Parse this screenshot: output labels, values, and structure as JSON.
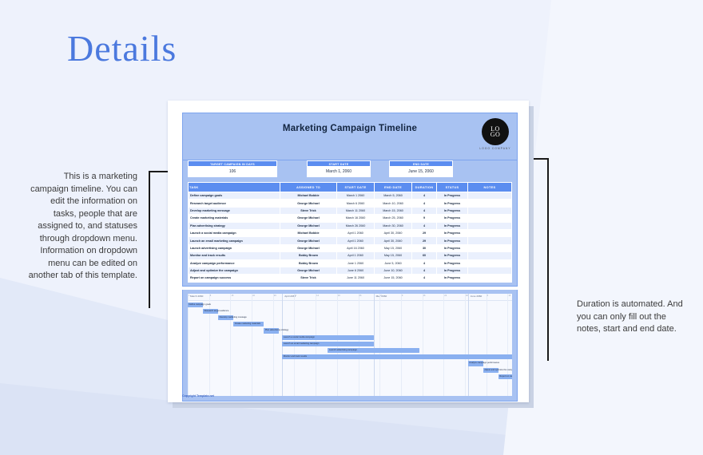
{
  "page": {
    "title": "Details"
  },
  "document": {
    "header": {
      "title": "Marketing Campaign Timeline",
      "logo_line1": "LO",
      "logo_line2": "GO",
      "logo_subtitle": "LOGO COMPANY"
    },
    "info_boxes": [
      {
        "label": "TARGET CAMPAIGN IN DAYS",
        "value": "106"
      },
      {
        "label": "START DATE",
        "value": "March 1, 2060"
      },
      {
        "label": "END DATE",
        "value": "June 15, 2060"
      }
    ],
    "table": {
      "columns": [
        "TASK",
        "ASSIGNED TO",
        "START DATE",
        "END DATE",
        "DURATION",
        "STATUS",
        "NOTES"
      ],
      "rows": [
        [
          "Define campaign goals",
          "Michael Bobbie",
          "March 1 2060",
          "March 5, 2060",
          "4",
          "In Progress",
          ""
        ],
        [
          "Research target audience",
          "George Michael",
          "March 6 2060",
          "March 10, 2060",
          "4",
          "In Progress",
          ""
        ],
        [
          "Develop marketing message",
          "Steve Trick",
          "March 11 2060",
          "March 15, 2060",
          "4",
          "In Progress",
          ""
        ],
        [
          "Create marketing materials",
          "George Michael",
          "March 16 2060",
          "March 25, 2060",
          "9",
          "In Progress",
          ""
        ],
        [
          "Plan advertising strategy",
          "George Michael",
          "March 26 2060",
          "March 30, 2060",
          "4",
          "In Progress",
          ""
        ],
        [
          "Launch a social media campaign",
          "Michael Bobbie",
          "April 1 2060",
          "April 30, 2060",
          "29",
          "In Progress",
          ""
        ],
        [
          "Launch an email marketing campaign",
          "George Michael",
          "April 1 2060",
          "April 30, 2060",
          "29",
          "In Progress",
          ""
        ],
        [
          "Launch advertising campaign",
          "George Michael",
          "April 16 2060",
          "May 15, 2060",
          "30",
          "In Progress",
          ""
        ],
        [
          "Monitor and track results",
          "Bobby Brown",
          "April 1 2060",
          "May 15, 2060",
          "60",
          "In Progress",
          ""
        ],
        [
          "Analyze campaign performance",
          "Bobby Brown",
          "June 1 2060",
          "June 5, 2060",
          "4",
          "In Progress",
          ""
        ],
        [
          "Adjust and optimize the campaign",
          "George Michael",
          "June 6 2060",
          "June 10, 2060",
          "4",
          "In Progress",
          ""
        ],
        [
          "Report on campaign success",
          "Steve Trick",
          "June 11 2060",
          "June 15, 2060",
          "4",
          "In Progress",
          ""
        ]
      ]
    },
    "gantt": {
      "months": [
        "March 2060",
        "April 2060",
        "May 2060",
        "June 2060"
      ],
      "bars": [
        {
          "label": "Define campaign goals",
          "start": 0,
          "length": 5
        },
        {
          "label": "Research target audience",
          "start": 5,
          "length": 5
        },
        {
          "label": "Develop marketing message",
          "start": 10,
          "length": 5
        },
        {
          "label": "Create marketing materials",
          "start": 15,
          "length": 10
        },
        {
          "label": "Plan advertising strategy",
          "start": 25,
          "length": 5
        },
        {
          "label": "Launch a social media campaign",
          "start": 31,
          "length": 30
        },
        {
          "label": "Launch an email marketing campaign",
          "start": 31,
          "length": 30
        },
        {
          "label": "Launch advertising campaign",
          "start": 46,
          "length": 30
        },
        {
          "label": "Monitor and track results",
          "start": 31,
          "length": 76
        },
        {
          "label": "Analyze campaign performance",
          "start": 92,
          "length": 5
        },
        {
          "label": "Adjust and optimize the campaign",
          "start": 97,
          "length": 5
        },
        {
          "label": "Report on campaign success",
          "start": 102,
          "length": 5
        }
      ]
    },
    "footer": "Copyright Template.net"
  },
  "annotations": {
    "left": "This is a marketing campaign timeline. You can edit the information on tasks, people that are assigned to, and statuses through dropdown menu. Information on dropdown menu can be edited on another tab of this template.",
    "right": "Duration is automated. And you can only fill out the notes, start and end date."
  }
}
